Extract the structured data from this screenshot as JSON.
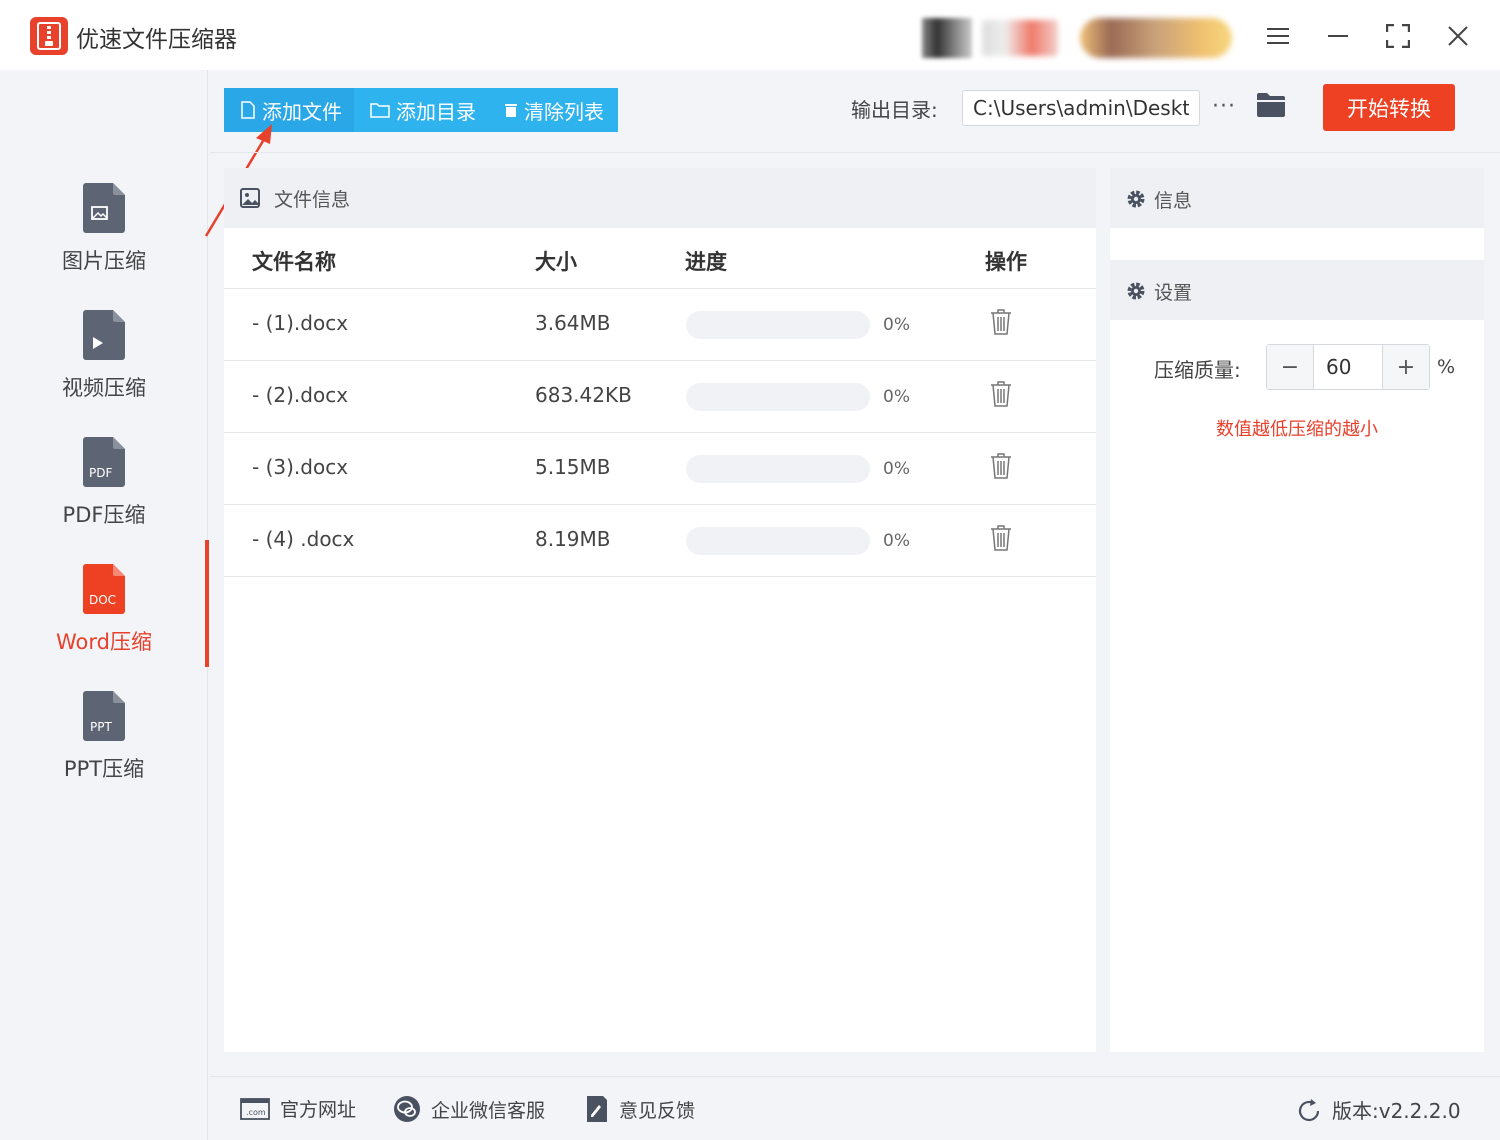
{
  "app": {
    "title": "优速文件压缩器"
  },
  "sidebar": {
    "items": [
      {
        "label": "图片压缩",
        "icon": "image-file-icon",
        "badge": ""
      },
      {
        "label": "视频压缩",
        "icon": "video-file-icon",
        "badge": ""
      },
      {
        "label": "PDF压缩",
        "icon": "pdf-file-icon",
        "badge": "PDF"
      },
      {
        "label": "Word压缩",
        "icon": "doc-file-icon",
        "badge": "DOC"
      },
      {
        "label": "PPT压缩",
        "icon": "ppt-file-icon",
        "badge": "PPT"
      }
    ],
    "active_index": 3
  },
  "toolbar": {
    "add_file": "添加文件",
    "add_dir": "添加目录",
    "clear_list": "清除列表"
  },
  "output": {
    "label": "输出目录:",
    "path": "C:\\Users\\admin\\Deskto",
    "more": "···",
    "start_button": "开始转换"
  },
  "file_panel": {
    "title": "文件信息",
    "columns": {
      "name": "文件名称",
      "size": "大小",
      "progress": "进度",
      "action": "操作"
    },
    "files": [
      {
        "name": "- (1).docx",
        "size": "3.64MB",
        "progress": "0%",
        "progress_value": 0
      },
      {
        "name": "- (2).docx",
        "size": "683.42KB",
        "progress": "0%",
        "progress_value": 0
      },
      {
        "name": "- (3).docx",
        "size": "5.15MB",
        "progress": "0%",
        "progress_value": 0
      },
      {
        "name": "- (4) .docx",
        "size": "8.19MB",
        "progress": "0%",
        "progress_value": 0
      }
    ]
  },
  "info_panel": {
    "title": "信息"
  },
  "settings": {
    "title": "设置",
    "quality_label": "压缩质量:",
    "quality_value": "60",
    "minus": "−",
    "plus": "+",
    "unit": "%",
    "hint": "数值越低压缩的越小"
  },
  "footer": {
    "website": "官方网址",
    "wechat": "企业微信客服",
    "feedback": "意见反馈",
    "version": "版本:v2.2.2.0"
  },
  "colors": {
    "accent_red": "#e8412c",
    "toolbar_blue": "#2fb3ef",
    "start_button": "#ee4123"
  }
}
